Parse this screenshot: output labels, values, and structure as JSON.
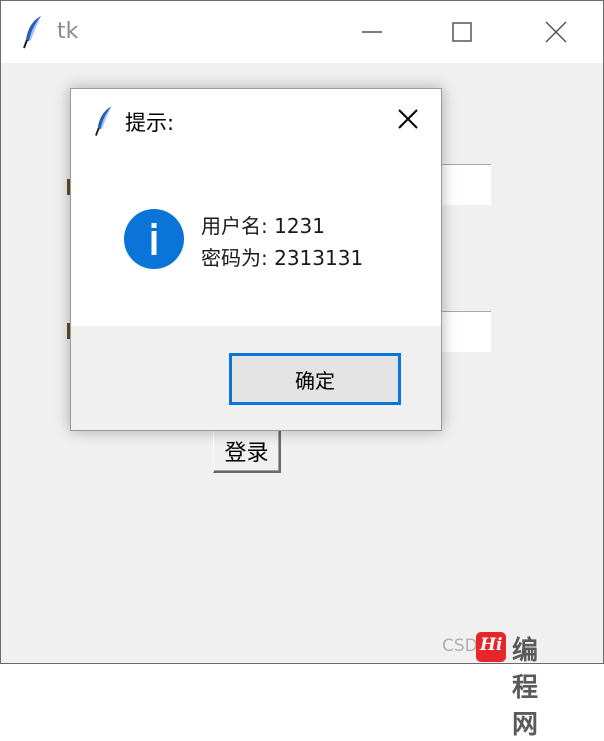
{
  "window": {
    "title": "tk",
    "icon": "feather-icon"
  },
  "form": {
    "login_label": "登录"
  },
  "dialog": {
    "title": "提示:",
    "icon": "info-icon",
    "message_lines": [
      "用户名: 1231",
      "密码为: 2313131"
    ],
    "ok_label": "确定",
    "accent_color": "#0a74d8"
  },
  "watermark": {
    "prefix": "CSD",
    "logo_text": "Hi",
    "text": "编程网"
  }
}
